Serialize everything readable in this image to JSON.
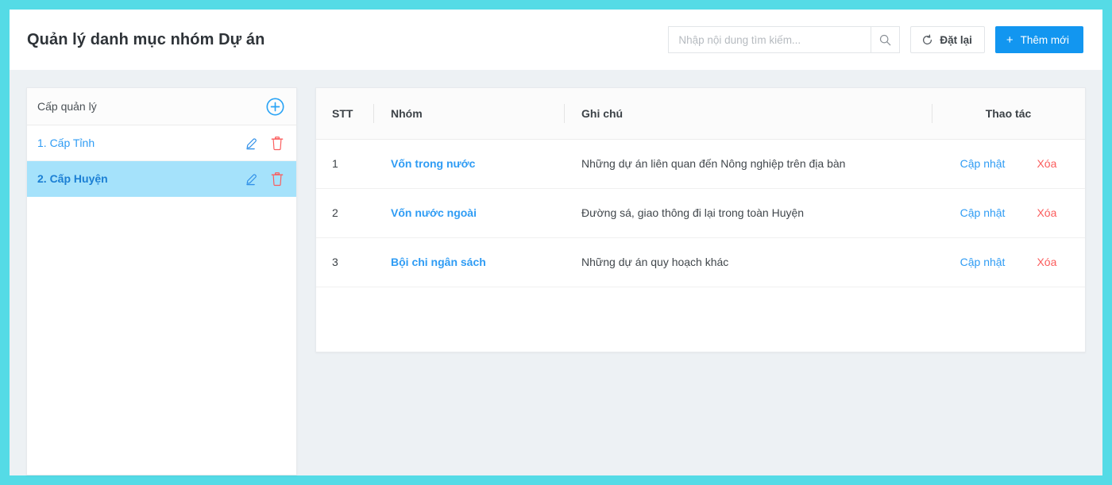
{
  "theme": {
    "frame_color": "#55dbe6",
    "accent_blue": "#1296f0",
    "link_blue": "#2f9cf4",
    "danger_red": "#fb5c5c",
    "selected_row": "#a5e2fb",
    "page_bg": "#edf1f4"
  },
  "header": {
    "title": "Quản lý danh mục nhóm Dự án",
    "search": {
      "placeholder": "Nhập nội dung tìm kiếm...",
      "value": "",
      "icon": "search-icon"
    },
    "reset_button": {
      "label": "Đặt lại",
      "icon": "refresh-icon"
    },
    "add_button": {
      "label": "Thêm mới",
      "icon": "plus-icon",
      "plus": "+"
    }
  },
  "sidebar": {
    "title": "Cấp quản lý",
    "add_icon": "circle-plus-icon",
    "items": [
      {
        "label": "1. Cấp Tỉnh",
        "selected": false,
        "edit_icon": "pencil-icon",
        "delete_icon": "trash-icon"
      },
      {
        "label": "2. Cấp Huyện",
        "selected": true,
        "edit_icon": "pencil-icon",
        "delete_icon": "trash-icon"
      }
    ]
  },
  "table": {
    "columns": {
      "stt": "STT",
      "group": "Nhóm",
      "note": "Ghi chú",
      "action": "Thao tác"
    },
    "action_labels": {
      "update": "Cập nhật",
      "delete": "Xóa"
    },
    "rows": [
      {
        "stt": "1",
        "group": "Vốn trong nước",
        "note": "Những dự án liên quan đến Nông nghiệp trên địa bàn",
        "update": "Cập nhật",
        "delete": "Xóa"
      },
      {
        "stt": "2",
        "group": "Vốn nước ngoài",
        "note": "Đường sá, giao thông đi lại trong toàn Huyện",
        "update": "Cập nhật",
        "delete": "Xóa"
      },
      {
        "stt": "3",
        "group": "Bội chi ngân sách",
        "note": "Những dự án quy hoạch khác",
        "update": "Cập nhật",
        "delete": "Xóa"
      }
    ]
  }
}
